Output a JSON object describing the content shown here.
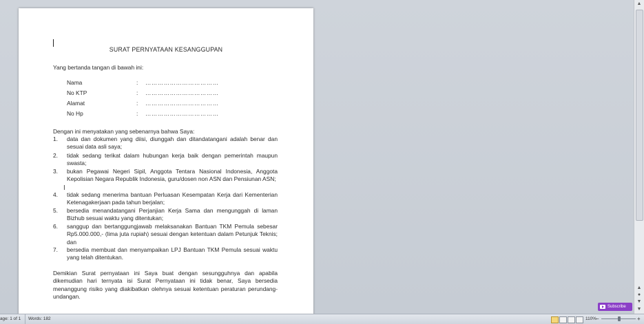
{
  "document": {
    "title": "SURAT PERNYATAAN KESANGGUPAN",
    "intro": "Yang bertanda tangan di bawah ini:",
    "fields": [
      {
        "label": "Nama",
        "colon": ":",
        "value": "………………………………"
      },
      {
        "label": "No KTP",
        "colon": ":",
        "value": "………………………………"
      },
      {
        "label": "Alamat",
        "colon": ":",
        "value": "………………………………"
      },
      {
        "label": "No Hp",
        "colon": ":",
        "value": "………………………………"
      }
    ],
    "lead": "Dengan ini menyatakan yang sebenarnya bahwa Saya:",
    "items": [
      {
        "num": "1.",
        "text": "data dan dokumen yang diisi, diunggah dan ditandatangani adalah benar dan sesuai data asli saya;"
      },
      {
        "num": "2.",
        "text": "tidak sedang terikat dalam hubungan kerja baik dengan pemerintah maupun swasta;"
      },
      {
        "num": "3.",
        "text": "bukan Pegawai Negeri Sipil, Anggota Tentara Nasional Indonesia, Anggota Kepolisian Negara Republik Indonesia, guru/dosen non ASN dan Pensiunan ASN;"
      },
      {
        "num": "4.",
        "text": "tidak sedang menerima bantuan Perluasan Kesempatan Kerja dari Kementerian Ketenagakerjaan pada tahun berjalan;"
      },
      {
        "num": "5.",
        "text": "bersedia menandatangani Perjanjian Kerja Sama dan mengunggah di laman Bizhub sesuai waktu yang ditentukan;"
      },
      {
        "num": "6.",
        "text": "sanggup dan bertanggungjawab melaksanakan Bantuan TKM Pemula sebesar Rp5.000.000,- (lima juta rupiah) sesuai dengan ketentuan dalam Petunjuk Teknis; dan"
      },
      {
        "num": "7.",
        "text": "bersedia membuat dan menyampaikan LPJ Bantuan TKM Pemula sesuai waktu yang telah ditentukan."
      }
    ],
    "closing": "Demikian Surat pernyataan ini Saya buat dengan sesungguhnya dan apabila dikemudian hari ternyata isi Surat Pernyataan ini tidak benar, Saya bersedia menanggung risiko yang diakibatkan olehnya sesuai ketentuan peraturan perundang-undangan."
  },
  "status_bar": {
    "page": "age: 1 of 1",
    "words": "Words: 182",
    "zoom": "110%",
    "zoom_minus": "−",
    "zoom_plus": "+"
  },
  "overlay": {
    "subscribe_label": "Subscribe"
  },
  "scrollbar": {
    "up": "▲",
    "down": "▼",
    "prev_page": "▲",
    "browse": "●",
    "next_page": "▼"
  },
  "colors": {
    "workspace": "#c9ced6",
    "subscribe": "#8b3fc7",
    "page": "#ffffff"
  }
}
